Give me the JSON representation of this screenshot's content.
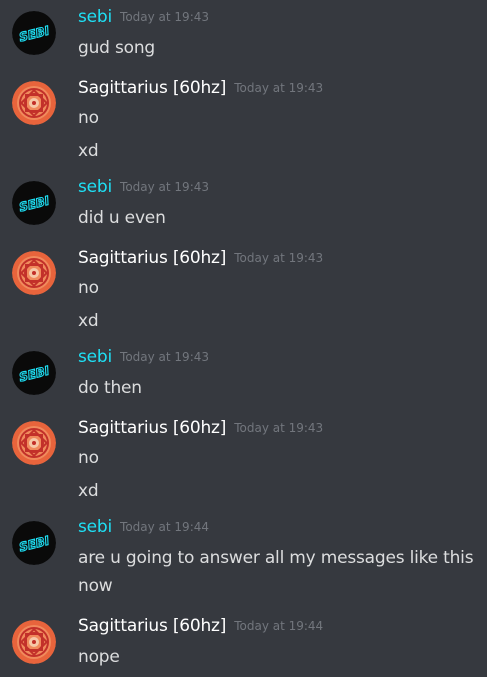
{
  "messages": [
    {
      "author": "sebi",
      "timestamp": "Today at 19:43",
      "lines": [
        "gud song"
      ]
    },
    {
      "author": "Sagittarius [60hz]",
      "timestamp": "Today at 19:43",
      "lines": [
        "no",
        "xd"
      ]
    },
    {
      "author": "sebi",
      "timestamp": "Today at 19:43",
      "lines": [
        "did u even"
      ]
    },
    {
      "author": "Sagittarius [60hz]",
      "timestamp": "Today at 19:43",
      "lines": [
        "no",
        "xd"
      ]
    },
    {
      "author": "sebi",
      "timestamp": "Today at 19:43",
      "lines": [
        "do then"
      ]
    },
    {
      "author": "Sagittarius [60hz]",
      "timestamp": "Today at 19:43",
      "lines": [
        "no",
        "xd"
      ]
    },
    {
      "author": "sebi",
      "timestamp": "Today at 19:44",
      "lines": [
        "are u going to answer all my messages like this",
        "now"
      ]
    },
    {
      "author": "Sagittarius [60hz]",
      "timestamp": "Today at 19:44",
      "lines": [
        "nope"
      ]
    }
  ],
  "avatars": {
    "sebi": {
      "text": "SEBI",
      "text_color": "#1ee0f5",
      "bg_color": "#0a0a0a"
    },
    "sagittarius": {
      "icon": "mandala-icon",
      "outer_color": "#e8643c",
      "inner_color": "#f6c8a8"
    }
  },
  "colors": {
    "background": "#36393f",
    "sebi_name": "#1ee0f5",
    "sagittarius_name": "#ffffff",
    "message_text": "#dcddde",
    "timestamp": "#72767d"
  }
}
